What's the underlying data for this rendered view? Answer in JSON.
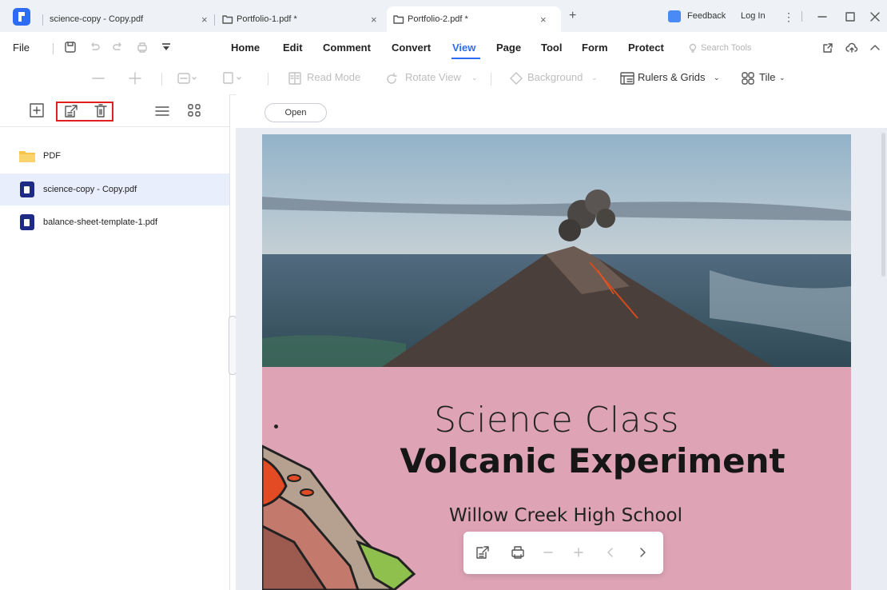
{
  "tabs": [
    {
      "label": "science-copy - Copy.pdf",
      "close": "×"
    },
    {
      "label": "Portfolio-1.pdf *",
      "close": "×"
    },
    {
      "label": "Portfolio-2.pdf *",
      "close": "×"
    }
  ],
  "titlebar": {
    "new_tab": "+",
    "feedback": "Feedback",
    "login": "Log In"
  },
  "menu": {
    "file": "File",
    "items": [
      "Home",
      "Edit",
      "Comment",
      "Convert",
      "View",
      "Page",
      "Tool",
      "Form",
      "Protect"
    ],
    "active": "View",
    "search_tools": "Search Tools"
  },
  "toolbar": {
    "read_mode": "Read Mode",
    "rotate_view": "Rotate View",
    "background": "Background",
    "rulers_grids": "Rulers & Grids",
    "tile": "Tile"
  },
  "sidebar": {
    "items": [
      {
        "name": "PDF",
        "type": "folder"
      },
      {
        "name": "science-copy - Copy.pdf",
        "type": "pdf",
        "selected": true
      },
      {
        "name": "balance-sheet-template-1.pdf",
        "type": "pdf"
      }
    ]
  },
  "viewer": {
    "open_label": "Open"
  },
  "document": {
    "line1": "Science Class",
    "line2": "Volcanic Experiment",
    "line3": "Willow Creek High School"
  },
  "colors": {
    "accent": "#2e6cf6",
    "page_pink": "#dea4b6",
    "highlight": "#e02020"
  }
}
